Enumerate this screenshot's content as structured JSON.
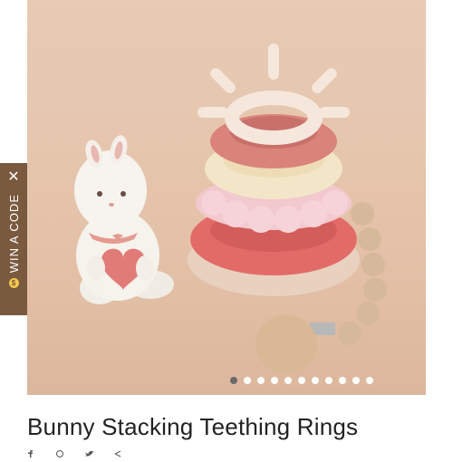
{
  "product": {
    "title": "Bunny Stacking Teething Rings",
    "images": {
      "count": 11,
      "active_index": 1
    }
  },
  "win_code": {
    "label": "WIN A CODE",
    "close_icon": "close-icon",
    "coin_icon": "coin-icon",
    "coin_symbol": "$"
  },
  "colors": {
    "tab_bg": "#7a5a3e",
    "background": "#e6c7ae"
  },
  "share_icons": [
    "facebook-icon",
    "pinterest-icon",
    "twitter-icon",
    "share-icon"
  ]
}
